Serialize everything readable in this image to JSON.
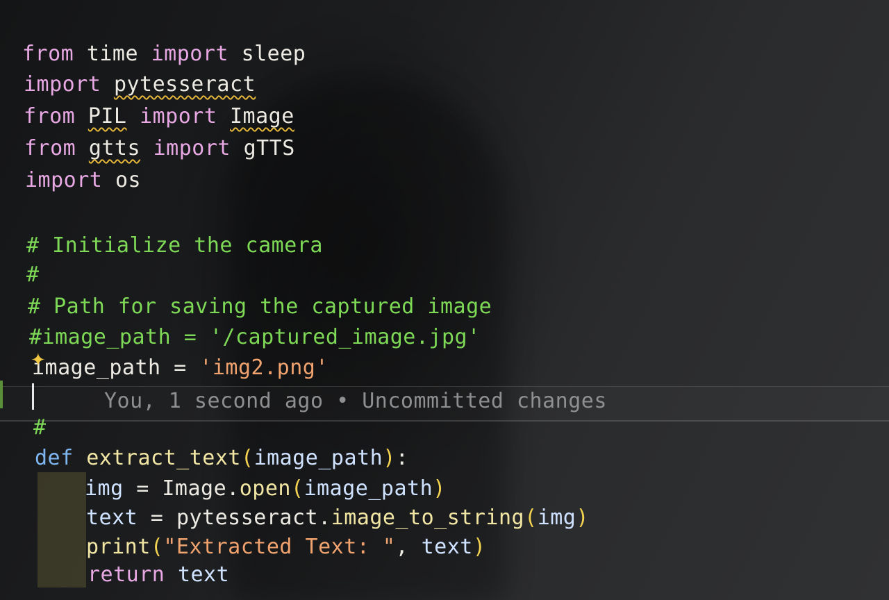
{
  "editor": {
    "lines": {
      "l1": {
        "kw1": "from",
        "mod": "time",
        "kw2": "import",
        "name": "sleep"
      },
      "l2": {
        "kw1": "import",
        "mod": "pytesseract"
      },
      "l3": {
        "kw1": "from",
        "mod": "PIL",
        "kw2": "import",
        "name": "Image"
      },
      "l4": {
        "kw1": "from",
        "mod": "gtts",
        "kw2": "import",
        "name": "gTTS"
      },
      "l5": {
        "kw1": "import",
        "mod": "os"
      },
      "l6": {
        "comment": "# Initialize the camera"
      },
      "l7": {
        "comment": "#"
      },
      "l8": {
        "comment": "# Path for saving the captured image"
      },
      "l9": {
        "comment": "#image_path = '/captured_image.jpg'"
      },
      "l10": {
        "var": "image_path",
        "op": " = ",
        "str": "'img2.png'"
      },
      "l11": {
        "blame": "You, 1 second ago • Uncommitted changes"
      },
      "l12": {
        "comment": "#"
      },
      "l13": {
        "kw": "def",
        "fn": "extract_text",
        "open": "(",
        "param": "image_path",
        "close": ")",
        "colon": ":"
      },
      "l14": {
        "var": "img",
        "op": " = ",
        "obj": "Image",
        "dot": ".",
        "fn": "open",
        "open": "(",
        "arg": "image_path",
        "close": ")"
      },
      "l15": {
        "var": "text",
        "op": " = ",
        "obj": "pytesseract",
        "dot": ".",
        "fn": "image_to_string",
        "open": "(",
        "arg": "img",
        "close": ")"
      },
      "l16": {
        "fn": "print",
        "open": "(",
        "str": "\"Extracted Text: \"",
        "comma": ", ",
        "arg": "text",
        "close": ")"
      },
      "l17": {
        "kw": "return",
        "arg": "text"
      }
    },
    "icons": {
      "lightbulb": "lightbulb-icon"
    }
  }
}
